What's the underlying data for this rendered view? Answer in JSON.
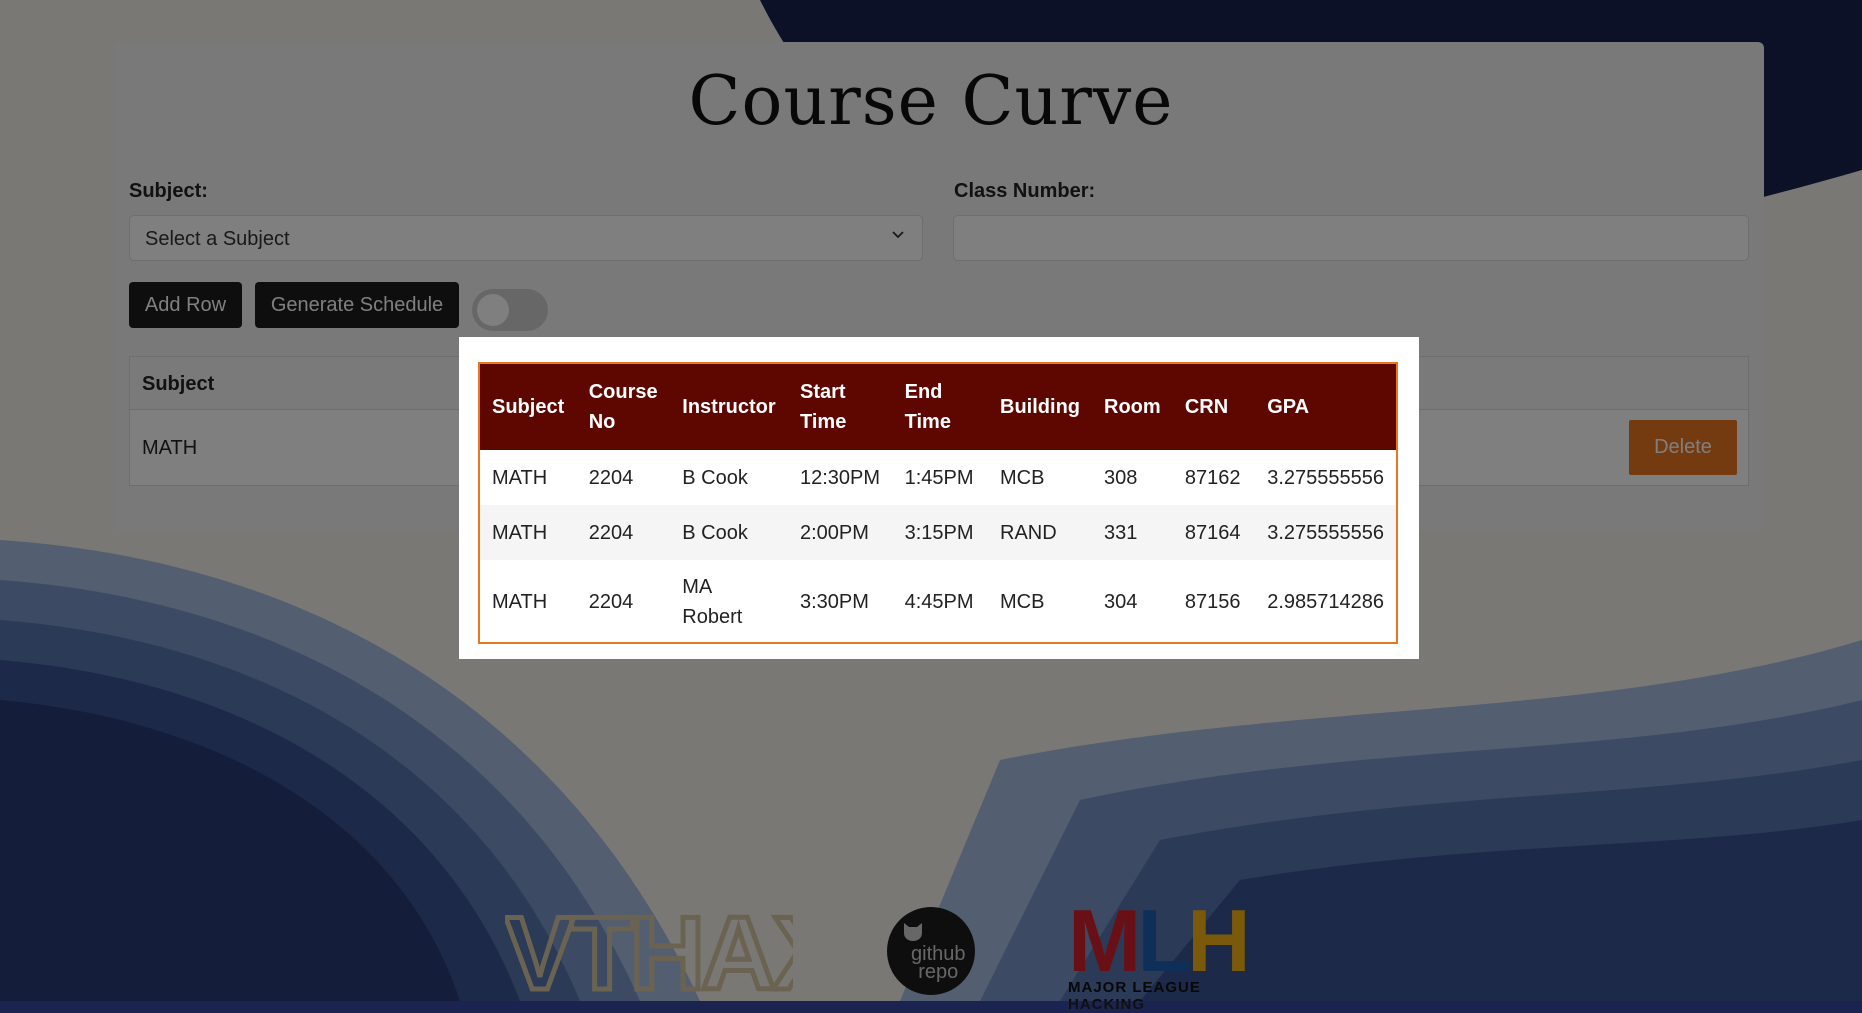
{
  "app": {
    "title": "Course Curve"
  },
  "form": {
    "subject_label": "Subject:",
    "subject_selected": "Select a Subject",
    "class_number_label": "Class Number:",
    "class_number_value": ""
  },
  "actions": {
    "add_row_label": "Add Row",
    "generate_schedule_label": "Generate Schedule",
    "toggle_on": false
  },
  "course_table": {
    "headers": [
      "Subject"
    ],
    "rows": [
      {
        "subject": "MATH",
        "delete_label": "Delete"
      }
    ]
  },
  "schedule_modal": {
    "headers": [
      "Subject",
      "Course No",
      "Instructor",
      "Start Time",
      "End Time",
      "Building",
      "Room",
      "CRN",
      "GPA"
    ],
    "rows": [
      [
        "MATH",
        "2204",
        "B Cook",
        "12:30PM",
        "1:45PM",
        "MCB",
        "308",
        "87162",
        "3.275555556"
      ],
      [
        "MATH",
        "2204",
        "B Cook",
        "2:00PM",
        "3:15PM",
        "RAND",
        "331",
        "87164",
        "3.275555556"
      ],
      [
        "MATH",
        "2204",
        "MA Robert",
        "3:30PM",
        "4:45PM",
        "MCB",
        "304",
        "87156",
        "2.985714286"
      ]
    ]
  },
  "footer": {
    "vthax_logo": "VTHAX",
    "github_line1": "github",
    "github_line2": "repo",
    "mlh_logo": "MLH",
    "mlh_tagline": "MAJOR LEAGUE HACKING"
  },
  "colors": {
    "accent_orange": "#e87722",
    "table_header_maroon": "#5e0700",
    "button_dark": "#1d1d1d",
    "background_navy": "#1b2350"
  }
}
